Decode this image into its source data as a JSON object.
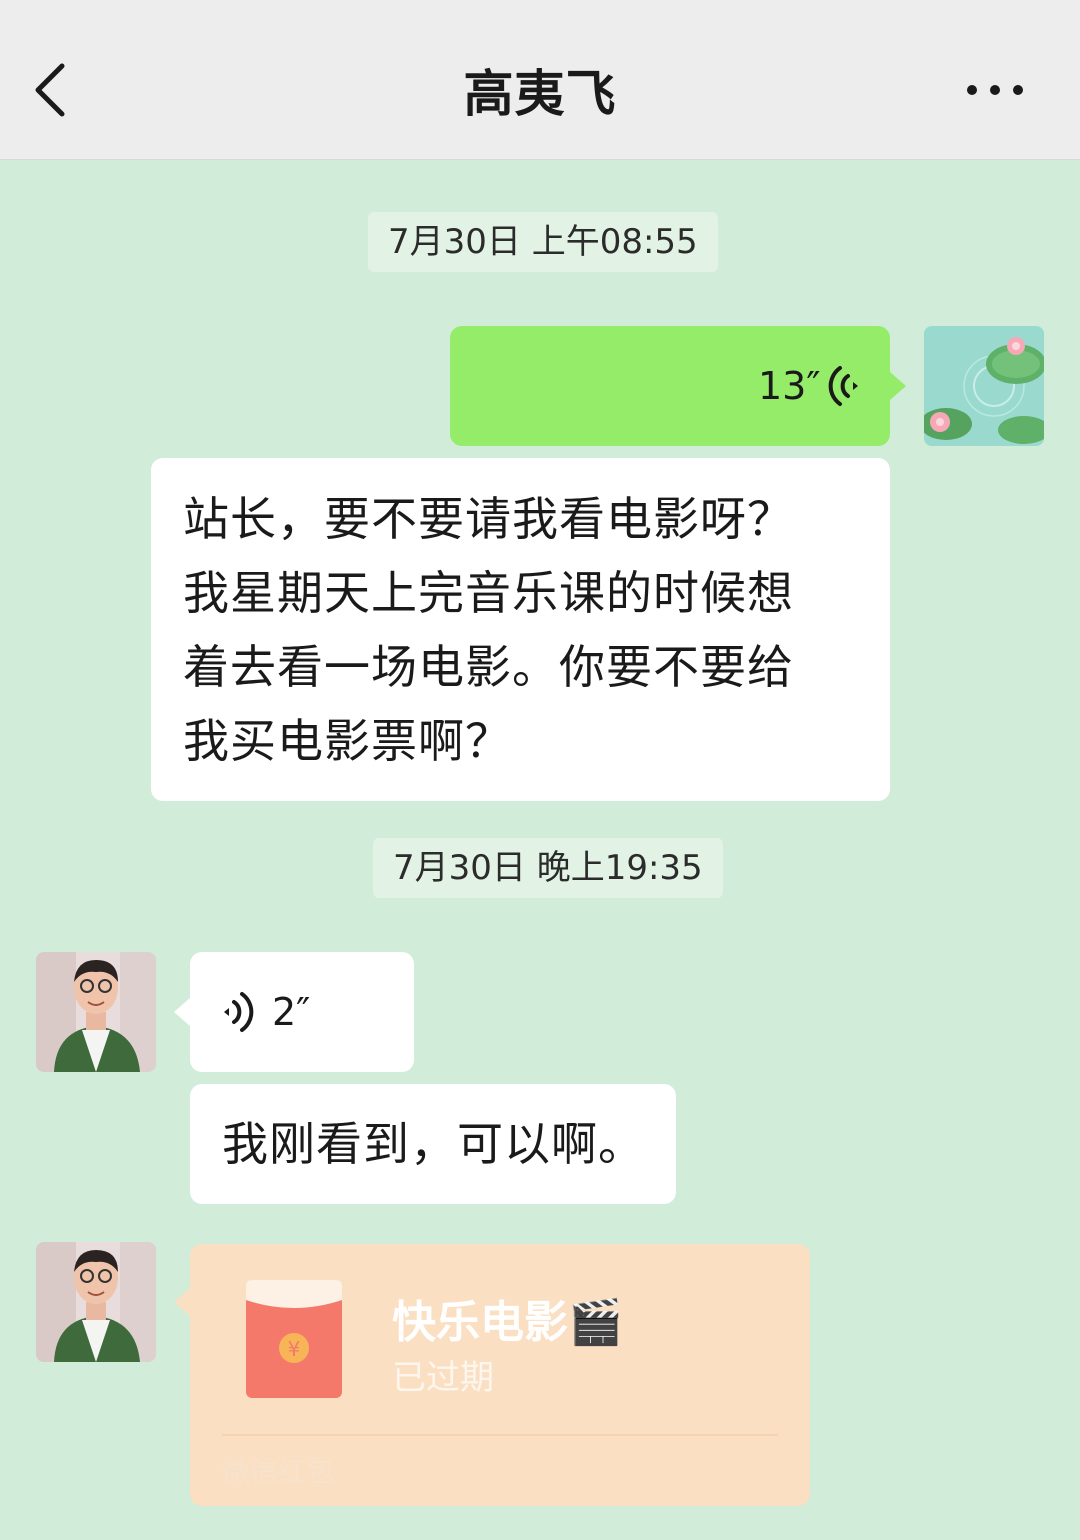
{
  "header": {
    "title": "高夷飞"
  },
  "messages": {
    "timestamp_1": "7月30日 上午08:55",
    "my_voice_duration": "13″",
    "my_text": "站长，要不要请我看电影呀？我星期天上完音乐课的时候想着去看一场电影。你要不要给我买电影票啊？",
    "my_text_lines": [
      "站长，要不要请我看电影呀？",
      "我星期天上完音乐课的时候想",
      "着去看一场电影。你要不要给",
      "我买电影票啊？"
    ],
    "timestamp_2": "7月30日 晚上19:35",
    "their_voice_duration": "2″",
    "their_text": "我刚看到，可以啊。",
    "red_packet": {
      "title": "快乐电影🎬",
      "status": "已过期",
      "footer": "微信红包"
    }
  },
  "colors": {
    "chat_background": "#d1ecd8",
    "sent_bubble": "#95ec69",
    "received_bubble": "#ffffff",
    "red_packet_card": "#fbdfc2",
    "red_envelope": "#f4796b"
  },
  "icons": {
    "back": "chevron-left-icon",
    "more": "ellipsis-icon",
    "voice_out": "voice-wave-icon",
    "voice_in": "voice-wave-icon",
    "currency": "yuan-icon"
  }
}
